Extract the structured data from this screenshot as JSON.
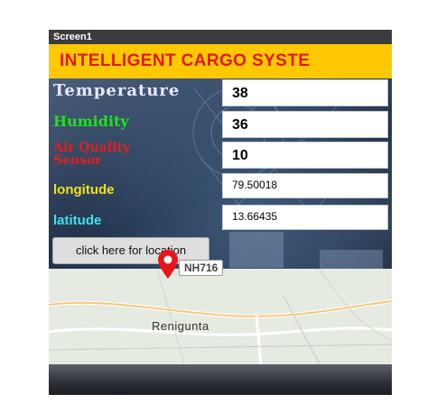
{
  "window": {
    "title": "Screen1"
  },
  "banner": {
    "text": "INTELLIGENT CARGO SYSTE"
  },
  "sensors": {
    "temperature": {
      "label": "Temperature",
      "value": "38"
    },
    "humidity": {
      "label": "Humidity",
      "value": "36"
    },
    "air_quality": {
      "label": "Air Quality Sensor",
      "value": "10"
    },
    "longitude": {
      "label": "longitude",
      "value": "79.50018"
    },
    "latitude": {
      "label": "latitude",
      "value": "13.66435"
    }
  },
  "location_button": {
    "label": "click here for location"
  },
  "map": {
    "road_shield": "NH716",
    "place_name": "Renigunta",
    "marker_icon": "map-pin-icon",
    "marker_color": "#e8141c"
  },
  "colors": {
    "banner_bg": "#ffc800",
    "banner_text": "#e01a1a",
    "temperature_label": "#e8e8ff",
    "humidity_label": "#22e022",
    "air_quality_label": "#e02020",
    "longitude_label": "#f0e020",
    "latitude_label": "#40e0f0"
  }
}
